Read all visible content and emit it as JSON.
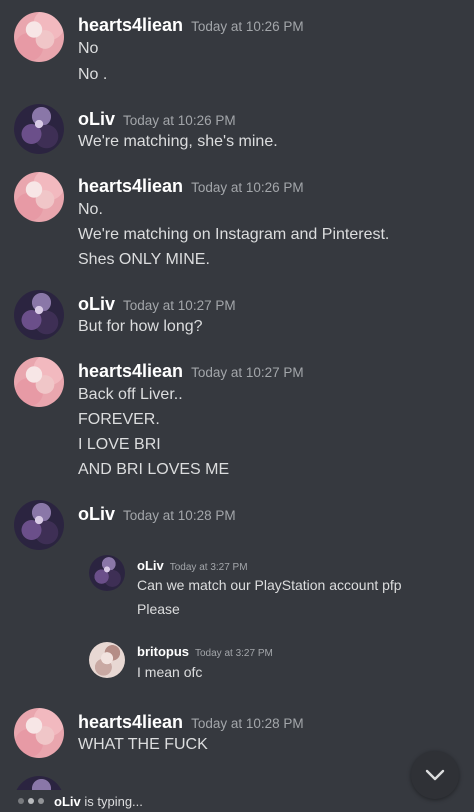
{
  "messages": [
    {
      "user": "hearts4liean",
      "time": "Today at 10:26 PM",
      "lines": [
        "No",
        "No ."
      ]
    },
    {
      "user": "oLiv",
      "time": "Today at 10:26 PM",
      "lines": [
        "We're matching, she's mine."
      ]
    },
    {
      "user": "hearts4liean",
      "time": "Today at 10:26 PM",
      "lines": [
        "No.",
        "We're matching on Instagram and Pinterest.",
        "Shes ONLY MINE."
      ]
    },
    {
      "user": "oLiv",
      "time": "Today at 10:27 PM",
      "lines": [
        "But for how long?"
      ]
    },
    {
      "user": "hearts4liean",
      "time": "Today at 10:27 PM",
      "lines": [
        "Back off Liver..",
        "FOREVER.",
        "I LOVE BRI",
        "AND BRI LOVES ME"
      ]
    },
    {
      "user": "oLiv",
      "time": "Today at 10:28 PM",
      "lines": []
    },
    {
      "user": "hearts4liean",
      "time": "Today at 10:28 PM",
      "lines": [
        "WHAT THE FUCK"
      ]
    }
  ],
  "embedded": [
    {
      "user": "oLiv",
      "time": "Today at 3:27 PM",
      "lines": [
        "Can we match our PlayStation account pfp",
        "Please"
      ]
    },
    {
      "user": "britopus",
      "time": "Today at 3:27 PM",
      "lines": [
        "I mean ofc"
      ]
    }
  ],
  "typing": {
    "user": "oLiv",
    "text": "is typing..."
  },
  "icons": {
    "scroll_down": "chevron-down-icon"
  },
  "colors": {
    "background": "#36393f",
    "username": "#ffffff",
    "timestamp": "#a3a6aa",
    "text": "#dcddde"
  }
}
